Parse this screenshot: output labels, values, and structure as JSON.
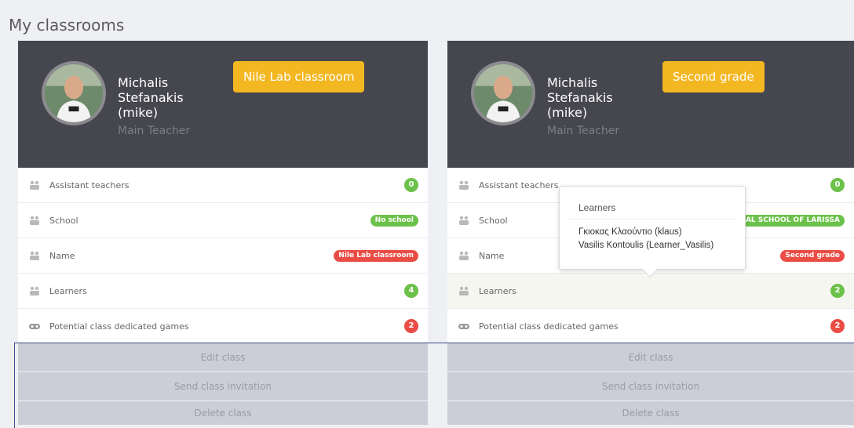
{
  "page": {
    "title": "My classrooms"
  },
  "classrooms": [
    {
      "teacher_name": "Michalis Stefanakis (mike)",
      "teacher_role": "Main Teacher",
      "class_badge": "Nile Lab classroom",
      "rows": {
        "assistant": {
          "label": "Assistant teachers",
          "value": "0"
        },
        "school": {
          "label": "School",
          "value": "No school"
        },
        "name": {
          "label": "Name",
          "value": "Nile Lab classroom"
        },
        "learners": {
          "label": "Learners",
          "value": "4"
        },
        "games": {
          "label": "Potential class dedicated games",
          "value": "2"
        }
      },
      "actions": {
        "edit": "Edit class",
        "invite": "Send class invitation",
        "delete": "Delete class"
      }
    },
    {
      "teacher_name": "Michalis Stefanakis (mike)",
      "teacher_role": "Main Teacher",
      "class_badge": "Second grade",
      "rows": {
        "assistant": {
          "label": "Assistant teachers",
          "value": "0"
        },
        "school": {
          "label": "School",
          "value": "AL SCHOOL OF LARISSA"
        },
        "name": {
          "label": "Name",
          "value": "Second grade"
        },
        "learners": {
          "label": "Learners",
          "value": "2"
        },
        "games": {
          "label": "Potential class dedicated games",
          "value": "2"
        }
      },
      "actions": {
        "edit": "Edit class",
        "invite": "Send class invitation",
        "delete": "Delete class"
      }
    }
  ],
  "tooltip": {
    "title": "Learners",
    "items": [
      "Γκιοκας Κλαούντιο (klaus)",
      "Vasilis Kontoulis (Learner_Vasilis)"
    ]
  },
  "icons": {
    "group": "users-icon",
    "games": "gamepad-icon"
  },
  "colors": {
    "header_bg": "#46464e",
    "accent": "#f3b722",
    "pill_green": "#6cc14a",
    "pill_red": "#ea4d45"
  }
}
